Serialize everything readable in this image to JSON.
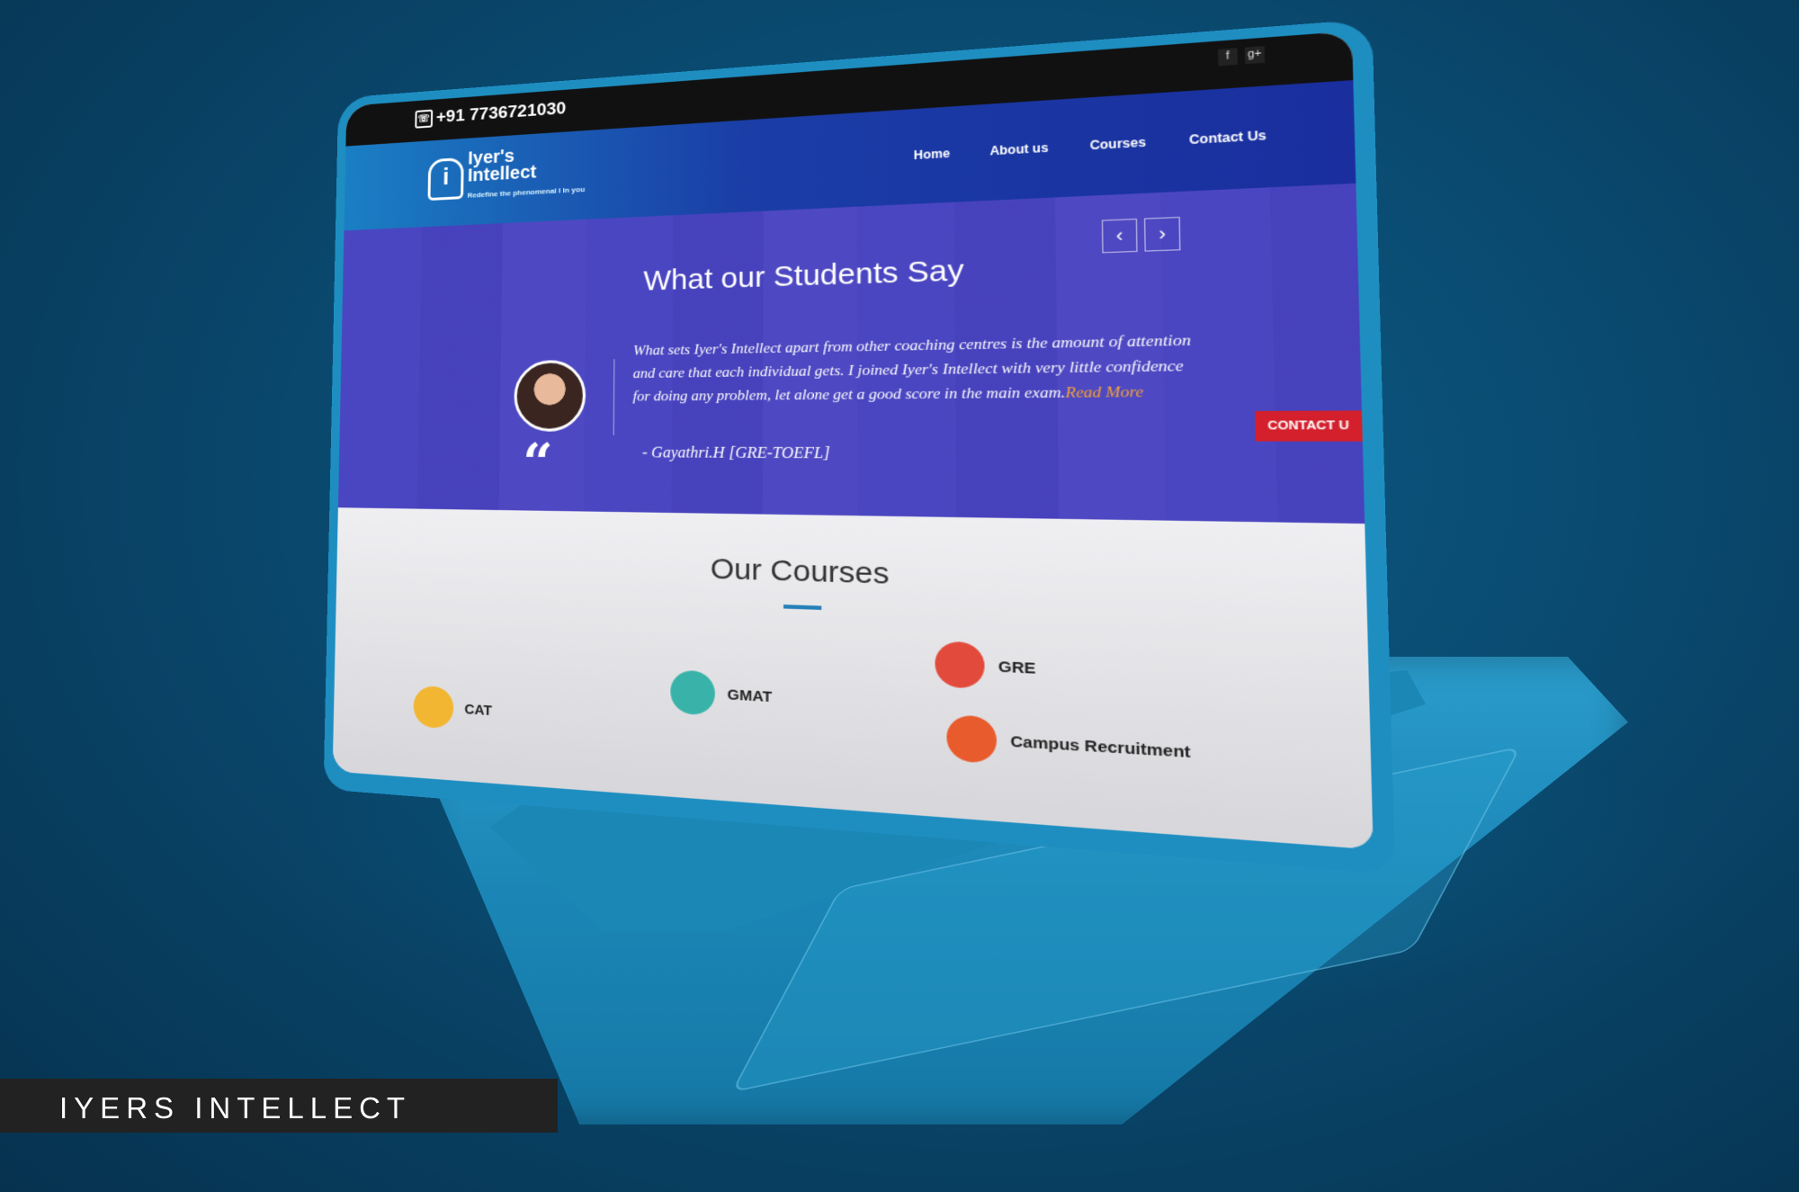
{
  "topbar": {
    "phone": "+91 7736721030",
    "social": [
      "f",
      "g+"
    ]
  },
  "logo": {
    "line1": "Iyer's",
    "line2": "Intellect",
    "tagline": "Redefine the phenomenal I in you"
  },
  "nav": {
    "items": [
      {
        "label": "Home"
      },
      {
        "label": "About us"
      },
      {
        "label": "Courses"
      },
      {
        "label": "Contact Us"
      }
    ]
  },
  "hero": {
    "title": "What our Students Say",
    "prev": "‹",
    "next": "›",
    "quote": "What sets Iyer's Intellect apart from other coaching centres is the amount of attention and care that each individual gets. I joined Iyer's Intellect with very little confidence for doing any problem, let alone get a good score in the main exam.",
    "read_more": "Read More",
    "author": "- Gayathri.H [GRE-TOEFL]",
    "quote_mark": "“",
    "contact_tab": "CONTACT U"
  },
  "courses": {
    "title": "Our Courses",
    "items": [
      {
        "label": "CAT",
        "icon": "brain-icon",
        "color": "#f2b632"
      },
      {
        "label": "GMAT",
        "icon": "book-icon",
        "color": "#39b3a9"
      },
      {
        "label": "GRE",
        "icon": "molecule-icon",
        "color": "#e24b3b"
      },
      {
        "label": "Campus Recruitment",
        "icon": "recruitment-icon",
        "color": "#e85b2c"
      }
    ]
  },
  "caption": "IYERS INTELLECT"
}
